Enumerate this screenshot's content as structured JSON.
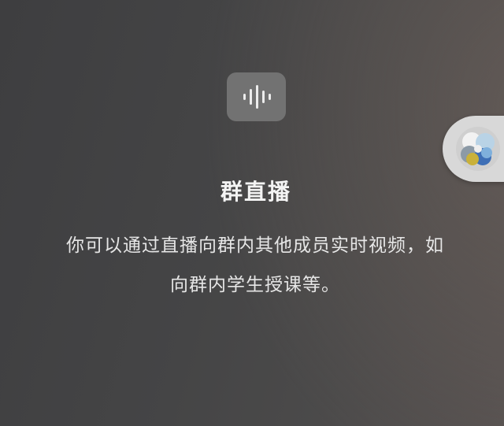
{
  "feature": {
    "icon": "voice-waveform-icon",
    "title": "群直播",
    "description_line1": "你可以通过直播向群内其他成员实时视频，如",
    "description_line2": "向群内学生授课等。"
  },
  "floating_assistant": {
    "icon": "app-logo-pinwheel-icon"
  },
  "colors": {
    "background": "#434343",
    "icon_tile": "#727272",
    "floating_button": "#d8d8d8"
  }
}
